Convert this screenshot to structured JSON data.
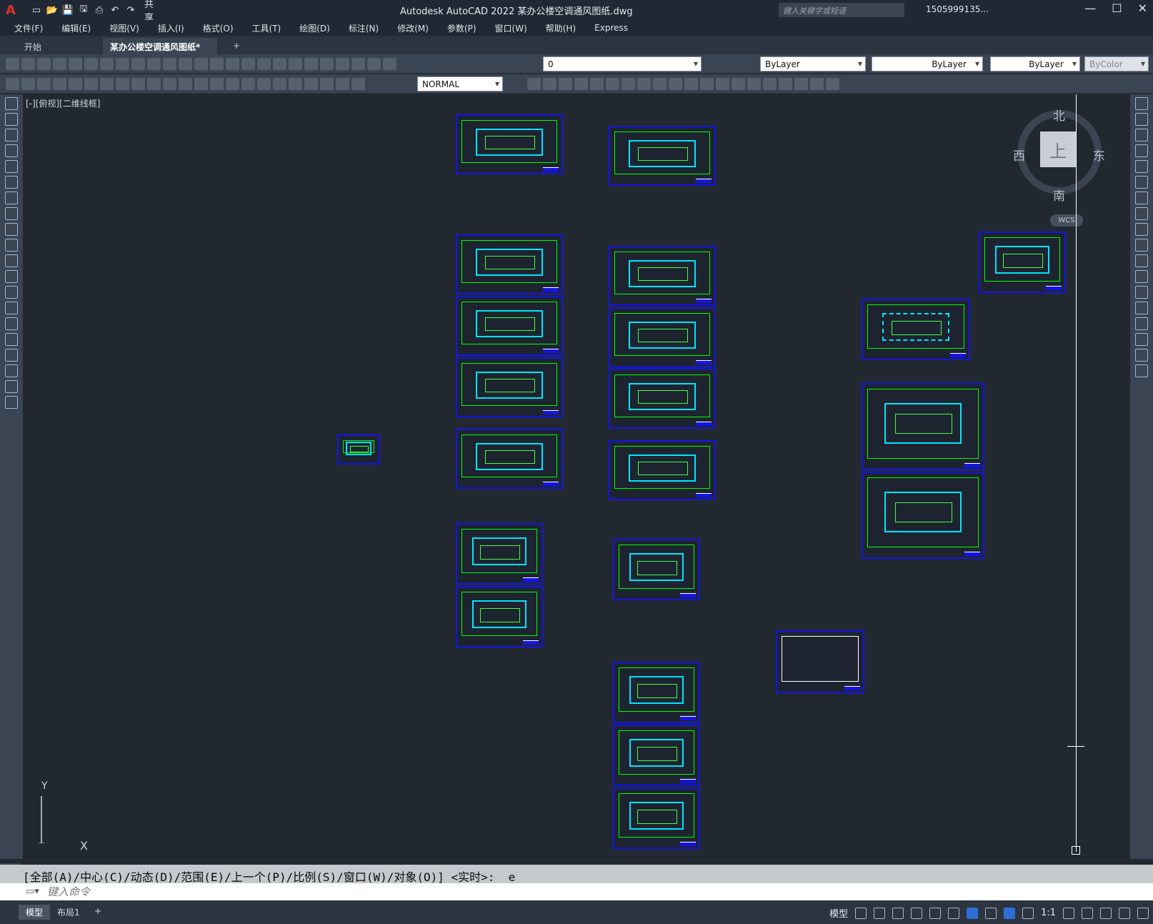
{
  "title_bar": {
    "app_title": "Autodesk AutoCAD 2022    某办公楼空调通风图纸.dwg",
    "share_label": "共享",
    "search_placeholder": "键入关键字或短语",
    "user_label": "1505999135...",
    "window_controls": [
      "—",
      "☐",
      "✕"
    ]
  },
  "menu": [
    "文件(F)",
    "编辑(E)",
    "视图(V)",
    "插入(I)",
    "格式(O)",
    "工具(T)",
    "绘图(D)",
    "标注(N)",
    "修改(M)",
    "参数(P)",
    "窗口(W)",
    "帮助(H)",
    "Express"
  ],
  "tabs": [
    {
      "label": "开始"
    },
    {
      "label": "某办公楼空调通风图纸*"
    }
  ],
  "toolbar": {
    "layer_value": "0",
    "color_value": "ByLayer",
    "linetype_value": "ByLayer",
    "lineweight_value": "ByLayer",
    "plotstyle_value": "ByColor",
    "textstyle_value": "NORMAL"
  },
  "canvas": {
    "view_label": "[-][俯视][二维线框]",
    "viewcube": {
      "top": "上",
      "north": "北",
      "south": "南",
      "east": "东",
      "west": "西",
      "wcs": "WCS"
    },
    "ucs_x": "X",
    "ucs_y": "Y"
  },
  "command": {
    "history": "[全部(A)/中心(C)/动态(D)/范围(E)/上一个(P)/比例(S)/窗口(W)/对象(O)] <实时>: _e",
    "placeholder": "键入命令"
  },
  "status": {
    "tabs": [
      "模型",
      "布局1"
    ],
    "model_label": "模型",
    "scale": "1:1"
  },
  "colors": {
    "sheet_border": "#1414e6",
    "plan_lines": "#00e5ff",
    "grid_lines": "#00ff00",
    "canvas_bg": "#212830"
  }
}
